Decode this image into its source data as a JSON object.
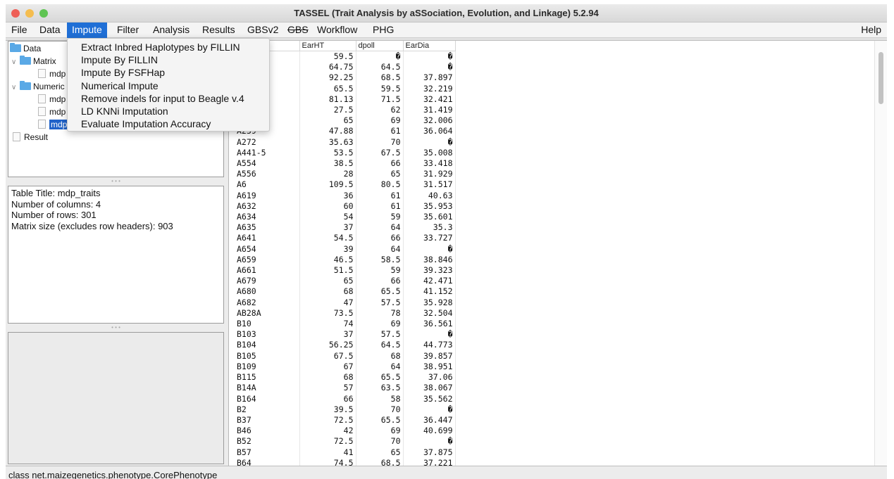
{
  "window": {
    "title": "TASSEL (Trait Analysis by aSSociation, Evolution, and Linkage) 5.2.94",
    "colors": {
      "close": "#ee5f57",
      "minimize": "#f5bd4f",
      "zoom": "#5fc453",
      "accent": "#1f6fd6"
    }
  },
  "menubar": {
    "items": [
      "File",
      "Data",
      "Impute",
      "Filter",
      "Analysis",
      "Results",
      "GBSv2",
      "GBS",
      "Workflow",
      "PHG"
    ],
    "active": "Impute",
    "help": "Help"
  },
  "impute_menu": [
    "Extract Inbred Haplotypes by FILLIN",
    "Impute By FILLIN",
    "Impute By FSFHap",
    "Numerical Impute",
    "Remove indels for input to Beagle v.4",
    "LD KNNi Imputation",
    "Evaluate Imputation Accuracy"
  ],
  "tree": {
    "data": "Data",
    "matrix": "Matrix",
    "matrix_child": "mdp",
    "numerical": "Numeric",
    "numerical_children": [
      "mdp",
      "mdp",
      "mdp"
    ],
    "result": "Result"
  },
  "info": {
    "line1": "Table Title: mdp_traits",
    "line2": "Number of columns: 4",
    "line3": "Number of rows: 301",
    "line4": "Matrix size (excludes row headers): 903"
  },
  "table": {
    "columns": [
      "",
      "EarHT",
      "dpoll",
      "EarDia"
    ],
    "rows": [
      [
        "",
        "59.5",
        "�",
        "�"
      ],
      [
        "",
        "64.75",
        "64.5",
        "�"
      ],
      [
        "",
        "92.25",
        "68.5",
        "37.897"
      ],
      [
        "",
        "65.5",
        "59.5",
        "32.219"
      ],
      [
        "",
        "81.13",
        "71.5",
        "32.421"
      ],
      [
        "",
        "27.5",
        "62",
        "31.419"
      ],
      [
        "",
        "65",
        "69",
        "32.006"
      ],
      [
        "A239",
        "47.88",
        "61",
        "36.064"
      ],
      [
        "A272",
        "35.63",
        "70",
        "�"
      ],
      [
        "A441-5",
        "53.5",
        "67.5",
        "35.008"
      ],
      [
        "A554",
        "38.5",
        "66",
        "33.418"
      ],
      [
        "A556",
        "28",
        "65",
        "31.929"
      ],
      [
        "A6",
        "109.5",
        "80.5",
        "31.517"
      ],
      [
        "A619",
        "36",
        "61",
        "40.63"
      ],
      [
        "A632",
        "60",
        "61",
        "35.953"
      ],
      [
        "A634",
        "54",
        "59",
        "35.601"
      ],
      [
        "A635",
        "37",
        "64",
        "35.3"
      ],
      [
        "A641",
        "54.5",
        "66",
        "33.727"
      ],
      [
        "A654",
        "39",
        "64",
        "�"
      ],
      [
        "A659",
        "46.5",
        "58.5",
        "38.846"
      ],
      [
        "A661",
        "51.5",
        "59",
        "39.323"
      ],
      [
        "A679",
        "65",
        "66",
        "42.471"
      ],
      [
        "A680",
        "68",
        "65.5",
        "41.152"
      ],
      [
        "A682",
        "47",
        "57.5",
        "35.928"
      ],
      [
        "AB28A",
        "73.5",
        "78",
        "32.504"
      ],
      [
        "B10",
        "74",
        "69",
        "36.561"
      ],
      [
        "B103",
        "37",
        "57.5",
        "�"
      ],
      [
        "B104",
        "56.25",
        "64.5",
        "44.773"
      ],
      [
        "B105",
        "67.5",
        "68",
        "39.857"
      ],
      [
        "B109",
        "67",
        "64",
        "38.951"
      ],
      [
        "B115",
        "68",
        "65.5",
        "37.06"
      ],
      [
        "B14A",
        "57",
        "63.5",
        "38.067"
      ],
      [
        "B164",
        "66",
        "58",
        "35.562"
      ],
      [
        "B2",
        "39.5",
        "70",
        "�"
      ],
      [
        "B37",
        "72.5",
        "65.5",
        "36.447"
      ],
      [
        "B46",
        "42",
        "69",
        "40.699"
      ],
      [
        "B52",
        "72.5",
        "70",
        "�"
      ],
      [
        "B57",
        "41",
        "65",
        "37.875"
      ],
      [
        "B64",
        "74.5",
        "68.5",
        "37.221"
      ]
    ]
  },
  "status": "class net.maizegenetics.phenotype.CorePhenotype"
}
